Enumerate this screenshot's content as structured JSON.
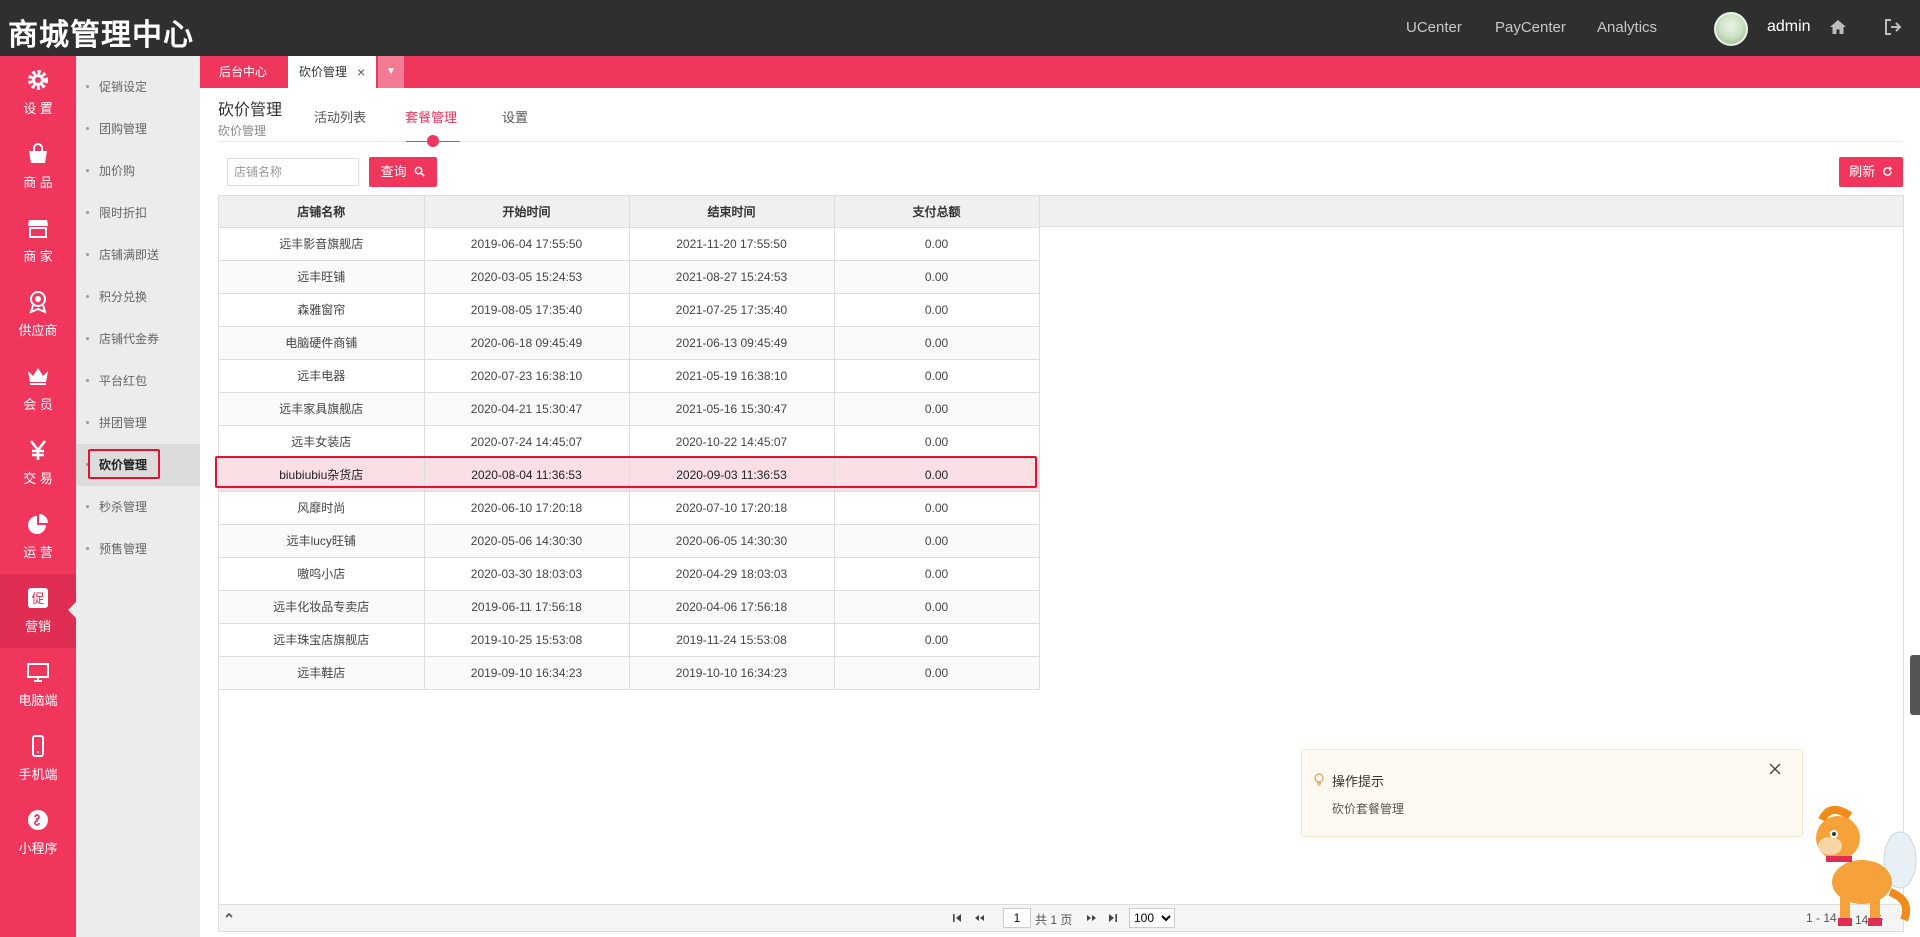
{
  "app": {
    "title": "商城管理中心"
  },
  "topnav": {
    "items": [
      "UCenter",
      "PayCenter",
      "Analytics"
    ],
    "user": "admin"
  },
  "leftnav": [
    {
      "label": "设 置",
      "icon": "gear-icon"
    },
    {
      "label": "商 品",
      "icon": "shopping-bag-icon"
    },
    {
      "label": "商 家",
      "icon": "store-icon"
    },
    {
      "label": "供应商",
      "icon": "award-icon"
    },
    {
      "label": "会 员",
      "icon": "crown-icon"
    },
    {
      "label": "交 易",
      "icon": "yen-icon"
    },
    {
      "label": "运 营",
      "icon": "pie-chart-icon"
    },
    {
      "label": "营销",
      "icon": "promo-icon"
    },
    {
      "label": "电脑端",
      "icon": "monitor-icon"
    },
    {
      "label": "手机端",
      "icon": "mobile-icon"
    },
    {
      "label": "小程序",
      "icon": "mini-program-icon"
    }
  ],
  "submenu": [
    "促销设定",
    "团购管理",
    "加价购",
    "限时折扣",
    "店铺满即送",
    "积分兑换",
    "店铺代金券",
    "平台红包",
    "拼团管理",
    "砍价管理",
    "秒杀管理",
    "预售管理"
  ],
  "tabs": {
    "home": "后台中心",
    "current": "砍价管理",
    "close": "×"
  },
  "page": {
    "title": "砍价管理",
    "subtitle": "砍价管理"
  },
  "subtabs": [
    "活动列表",
    "套餐管理",
    "设置"
  ],
  "search": {
    "placeholder": "店铺名称",
    "button": "查询",
    "refresh": "刷新"
  },
  "table": {
    "headers": [
      "店铺名称",
      "开始时间",
      "结束时间",
      "支付总额"
    ],
    "rows": [
      [
        "远丰影音旗舰店",
        "2019-06-04 17:55:50",
        "2021-11-20 17:55:50",
        "0.00"
      ],
      [
        "远丰旺铺",
        "2020-03-05 15:24:53",
        "2021-08-27 15:24:53",
        "0.00"
      ],
      [
        "森雅窗帘",
        "2019-08-05 17:35:40",
        "2021-07-25 17:35:40",
        "0.00"
      ],
      [
        "电脑硬件商铺",
        "2020-06-18 09:45:49",
        "2021-06-13 09:45:49",
        "0.00"
      ],
      [
        "远丰电器",
        "2020-07-23 16:38:10",
        "2021-05-19 16:38:10",
        "0.00"
      ],
      [
        "远丰家具旗舰店",
        "2020-04-21 15:30:47",
        "2021-05-16 15:30:47",
        "0.00"
      ],
      [
        "远丰女装店",
        "2020-07-24 14:45:07",
        "2020-10-22 14:45:07",
        "0.00"
      ],
      [
        "biubiubiu杂货店",
        "2020-08-04 11:36:53",
        "2020-09-03 11:36:53",
        "0.00"
      ],
      [
        "风靡时尚",
        "2020-06-10 17:20:18",
        "2020-07-10 17:20:18",
        "0.00"
      ],
      [
        "远丰lucy旺铺",
        "2020-05-06 14:30:30",
        "2020-06-05 14:30:30",
        "0.00"
      ],
      [
        "嗷呜小店",
        "2020-03-30 18:03:03",
        "2020-04-29 18:03:03",
        "0.00"
      ],
      [
        "远丰化妆品专卖店",
        "2019-06-11 17:56:18",
        "2020-04-06 17:56:18",
        "0.00"
      ],
      [
        "远丰珠宝店旗舰店",
        "2019-10-25 15:53:08",
        "2019-11-24 15:53:08",
        "0.00"
      ],
      [
        "远丰鞋店",
        "2019-09-10 16:34:23",
        "2019-10-10 16:34:23",
        "0.00"
      ]
    ]
  },
  "pager": {
    "page": "1",
    "total_pages": "共 1 页",
    "page_size": "100",
    "range": "1 - 14",
    "total": "14 条"
  },
  "tip": {
    "title": "操作提示",
    "content": "砍价套餐管理"
  },
  "colors": {
    "brand": "#f0365d",
    "topbar": "#2f2f2f",
    "selected_row": "#fbdfe7",
    "highlight_border": "#e8102e"
  }
}
